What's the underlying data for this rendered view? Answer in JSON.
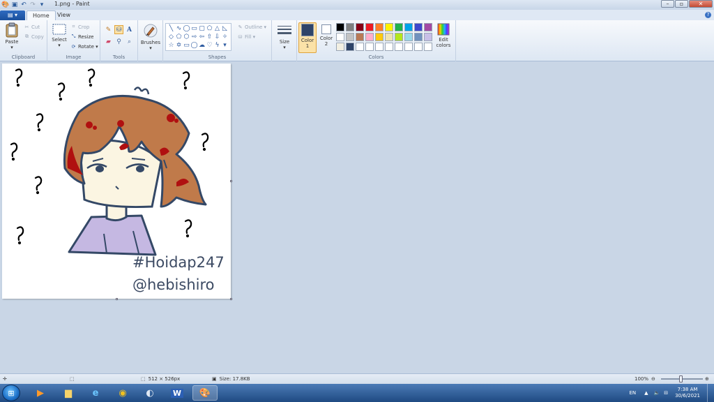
{
  "window": {
    "title": "1.png - Paint",
    "help": "?"
  },
  "tabs": {
    "app_menu": "▤ ▾",
    "home": "Home",
    "view": "View"
  },
  "clipboard": {
    "group_label": "Clipboard",
    "paste": "Paste",
    "cut": "Cut",
    "copy": "Copy"
  },
  "image": {
    "group_label": "Image",
    "select": "Select",
    "crop": "Crop",
    "resize": "Resize",
    "rotate": "Rotate ▾"
  },
  "tools": {
    "group_label": "Tools"
  },
  "brushes": {
    "label": "Brushes"
  },
  "shapes": {
    "group_label": "Shapes",
    "outline": "Outline ▾",
    "fill": "Fill ▾"
  },
  "size": {
    "label": "Size"
  },
  "colors": {
    "group_label": "Colors",
    "color1_label": "Color",
    "color1_num": "1",
    "color2_label": "Color",
    "color2_num": "2",
    "edit_label": "Edit",
    "edit_label2": "colors",
    "color1": "#2f4468",
    "color2": "#ffffff",
    "palette": [
      "#000000",
      "#7f7f7f",
      "#880015",
      "#ed1c24",
      "#ff7f27",
      "#fff200",
      "#22b14c",
      "#00a2e8",
      "#3f48cc",
      "#a349a4",
      "#ffffff",
      "#c3c3c3",
      "#b97a57",
      "#ffaec9",
      "#ffc90e",
      "#efe4b0",
      "#b5e61d",
      "#99d9ea",
      "#7092be",
      "#c8bfe7",
      "#f2efe2",
      "#2f4468",
      "#ffffff",
      "#ffffff",
      "#ffffff",
      "#ffffff",
      "#ffffff",
      "#ffffff",
      "#ffffff",
      "#ffffff"
    ]
  },
  "canvas": {
    "tag1": "#Hoidap247",
    "tag2": "@hebishiro"
  },
  "status": {
    "dimensions": "512 × 526px",
    "size": "Size: 17.8KB",
    "zoom": "100%"
  },
  "taskbar": {
    "language": "EN",
    "time": "7:38 AM",
    "date": "30/6/2021"
  }
}
